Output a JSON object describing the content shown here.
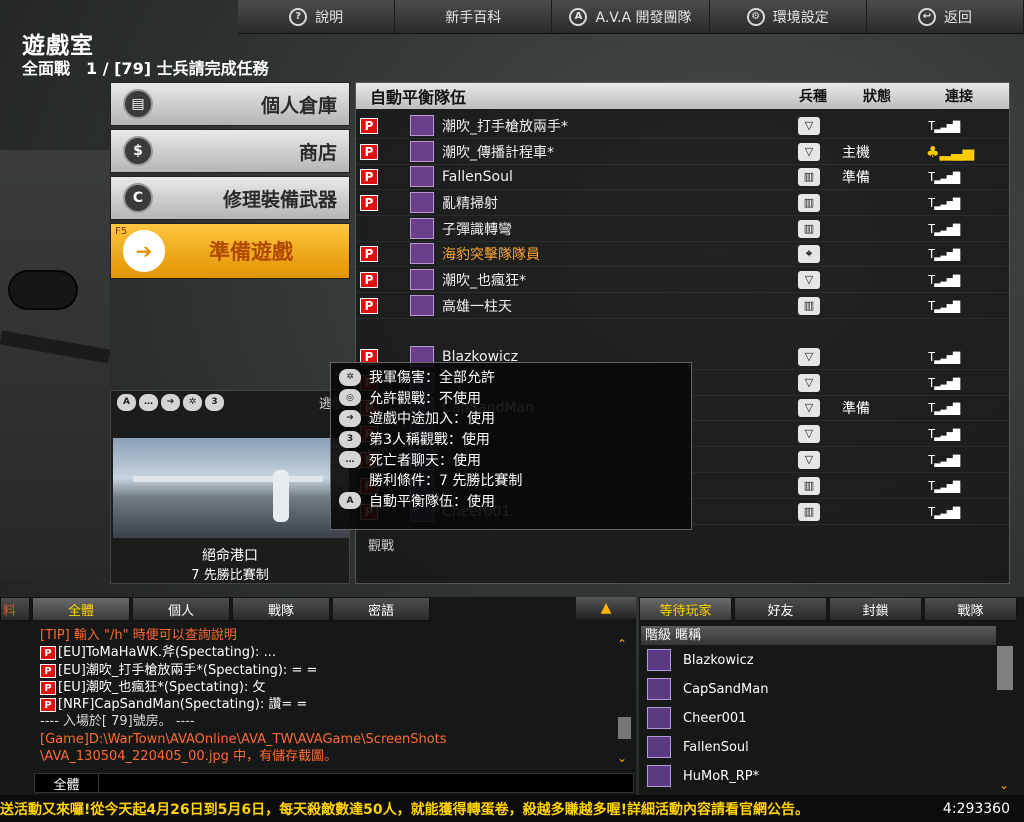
{
  "top": {
    "help": "說明",
    "wiki": "新手百科",
    "devteam": "A.V.A 開發團隊",
    "settings": "環境設定",
    "back": "返回"
  },
  "room": {
    "title": "遊戲室",
    "subtitle": "全面戰　1 / [79] 士兵請完成任務"
  },
  "menu": {
    "inventory": "個人倉庫",
    "shop": "商店",
    "repair": "修理裝備武器",
    "ready": "準備遊戲",
    "ready_key": "F5"
  },
  "map": {
    "escape": "逃脱",
    "name": "絕命港口",
    "mode": "7 先勝比賽制"
  },
  "team": {
    "header": "自動平衡隊伍",
    "col_class": "兵種",
    "col_state": "狀態",
    "col_conn": "連接",
    "spectate": "觀戰",
    "rows": [
      {
        "name": "潮吹_打手槍放兩手*",
        "state": "",
        "host": false,
        "p": true,
        "cls": "▽"
      },
      {
        "name": "潮吹_傳播計程車*",
        "state": "主機",
        "host": true,
        "p": true,
        "cls": "▽"
      },
      {
        "name": "FallenSoul",
        "state": "準備",
        "host": false,
        "p": true,
        "cls": "▥"
      },
      {
        "name": "亂精掃射",
        "state": "",
        "host": false,
        "p": true,
        "cls": "▥"
      },
      {
        "name": "子彈識轉彎",
        "state": "",
        "host": false,
        "p": false,
        "cls": "▥"
      },
      {
        "name": "海豹突擊隊隊員",
        "state": "",
        "host": false,
        "p": true,
        "cls": "⌖"
      },
      {
        "name": "潮吹_也瘋狂*",
        "state": "",
        "host": false,
        "p": true,
        "cls": "▽"
      },
      {
        "name": "高雄一柱天",
        "state": "",
        "host": false,
        "p": true,
        "cls": "▥"
      },
      {
        "name": "Blazkowicz",
        "state": "",
        "host": false,
        "p": true,
        "cls": "▽"
      },
      {
        "name": "",
        "state": "",
        "host": false,
        "p": true,
        "cls": "▽"
      },
      {
        "name": "CapSandMan",
        "state": "準備",
        "host": false,
        "p": true,
        "cls": "▽"
      },
      {
        "name": "",
        "state": "",
        "host": false,
        "p": true,
        "cls": "▽"
      },
      {
        "name": "",
        "state": "",
        "host": false,
        "p": true,
        "cls": "▽"
      },
      {
        "name": "",
        "state": "",
        "host": false,
        "p": true,
        "cls": "▥"
      },
      {
        "name": "Cheer001",
        "state": "",
        "host": false,
        "p": true,
        "cls": "▥"
      }
    ]
  },
  "tooltip": {
    "lines": [
      "我軍傷害：全部允許",
      "允許觀戰：不使用",
      "遊戲中途加入：使用",
      "第3人稱觀戰：使用",
      "死亡者聊天：使用",
      "勝利條件：7 先勝比賽制",
      "自動平衡隊伍：使用"
    ]
  },
  "chat": {
    "side_tab": "料",
    "tabs": [
      "全體",
      "個人",
      "戰隊",
      "密語"
    ],
    "channel": "全體",
    "lines": [
      {
        "type": "tip",
        "p": false,
        "text": "[TIP] 輸入 \"/h\" 時便可以查詢說明"
      },
      {
        "type": "msg",
        "p": true,
        "text": "[EU]ToMaHaWK.斧(Spectating): ..."
      },
      {
        "type": "msg",
        "p": true,
        "text": "[EU]潮吹_打手槍放兩手*(Spectating): = ="
      },
      {
        "type": "msg",
        "p": true,
        "text": "[EU]潮吹_也瘋狂*(Spectating): 攵"
      },
      {
        "type": "msg",
        "p": true,
        "text": "[NRF]CapSandMan(Spectating): 讚= ="
      },
      {
        "type": "info",
        "p": false,
        "text": "---- 入場於[ 79]號房。 ----"
      },
      {
        "type": "game",
        "p": false,
        "text": "[Game]D:\\WarTown\\AVAOnline\\AVA_TW\\AVAGame\\ScreenShots"
      },
      {
        "type": "game",
        "p": false,
        "text": "\\AVA_130504_220405_00.jpg 中，有儲存截圖。"
      }
    ]
  },
  "players": {
    "tabs": [
      "等待玩家",
      "好友",
      "封鎖",
      "戰隊"
    ],
    "header": "階級  暱稱",
    "list": [
      "Blazkowicz",
      "CapSandMan",
      "Cheer001",
      "FallenSoul",
      "HuMoR_RP*"
    ]
  },
  "ticker": {
    "text": "送活動又來囉!從今天起4月26日到5月6日，每天殺敵數達50人，就能獲得轉蛋卷，殺越多賺越多喔!詳細活動內容請看官網公告。",
    "count": "4:293360"
  }
}
